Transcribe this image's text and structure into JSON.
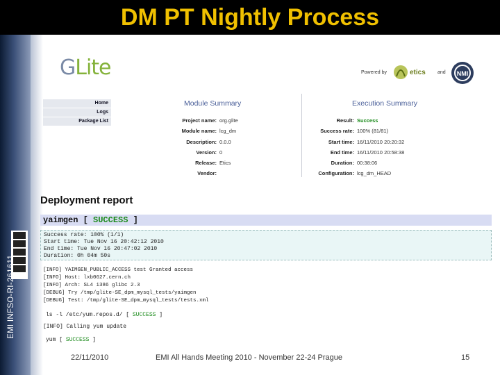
{
  "slide": {
    "title": "DM PT Nightly Process",
    "side_label": "EMI INFSO-RI-261611",
    "footer": {
      "date": "22/11/2010",
      "event": "EMI All Hands Meeting 2010 - November 22-24 Prague",
      "page": "15"
    }
  },
  "screenshot": {
    "logo_text_a": "G",
    "logo_text_b": "Lite",
    "powered_by": "Powered by",
    "etics": "etics",
    "and": "and",
    "nmi": "NMI",
    "nav": [
      "Home",
      "Logs",
      "Package List"
    ],
    "module_summary": {
      "title": "Module Summary",
      "rows": [
        {
          "k": "Project name:",
          "v": "org.glite"
        },
        {
          "k": "Module name:",
          "v": "lcg_dm"
        },
        {
          "k": "Description:",
          "v": ""
        },
        {
          "k": "Version:",
          "v": "0.0.0"
        },
        {
          "k": "Release:",
          "v": "0"
        },
        {
          "k": "Vendor:",
          "v": "Etics"
        }
      ]
    },
    "execution_summary": {
      "title": "Execution Summary",
      "rows": [
        {
          "k": "Result:",
          "v": "Success"
        },
        {
          "k": "Success rate:",
          "v": "100% (81/81)"
        },
        {
          "k": "Start time:",
          "v": "16/11/2010 20:20:32"
        },
        {
          "k": "End time:",
          "v": "16/11/2010 20:58:38"
        },
        {
          "k": "Duration:",
          "v": "00:38:06"
        },
        {
          "k": "Configuration:",
          "v": "lcg_dm_HEAD"
        }
      ],
      "result_color": "#1a8a1a"
    },
    "deployment": {
      "heading": "Deployment report",
      "yaim_label": "yaimgen [",
      "yaim_status": "SUCCESS",
      "yaim_close": "]",
      "summary_lines": [
        "Success rate: 100% (1/1)",
        "Start time: Tue Nov 16 20:42:12 2010",
        "End time: Tue Nov 16 20:47:02 2010",
        "Duration: 0h 04m 50s"
      ],
      "log_lines": [
        "[INFO] YAIMGEN_PUBLIC_ACCESS test Granted access",
        "[INFO] Host: lxb0627.cern.ch",
        "[INFO] Arch: SL4 i386 glibc 2.3",
        "[DEBUG] Try /tmp/glite-SE_dpm_mysql_tests/yaimgen",
        "[DEBUG] Test: /tmp/glite-SE_dpm_mysql_tests/tests.xml"
      ],
      "cmd1_label": "ls -l /etc/yum.repos.d/ [",
      "cmd1_status": "SUCCESS",
      "cmd1_close": "]",
      "info_line": "[INFO] Calling yum update",
      "cmd2_label": "yum [",
      "cmd2_status": "SUCCESS",
      "cmd2_close": "]"
    }
  }
}
